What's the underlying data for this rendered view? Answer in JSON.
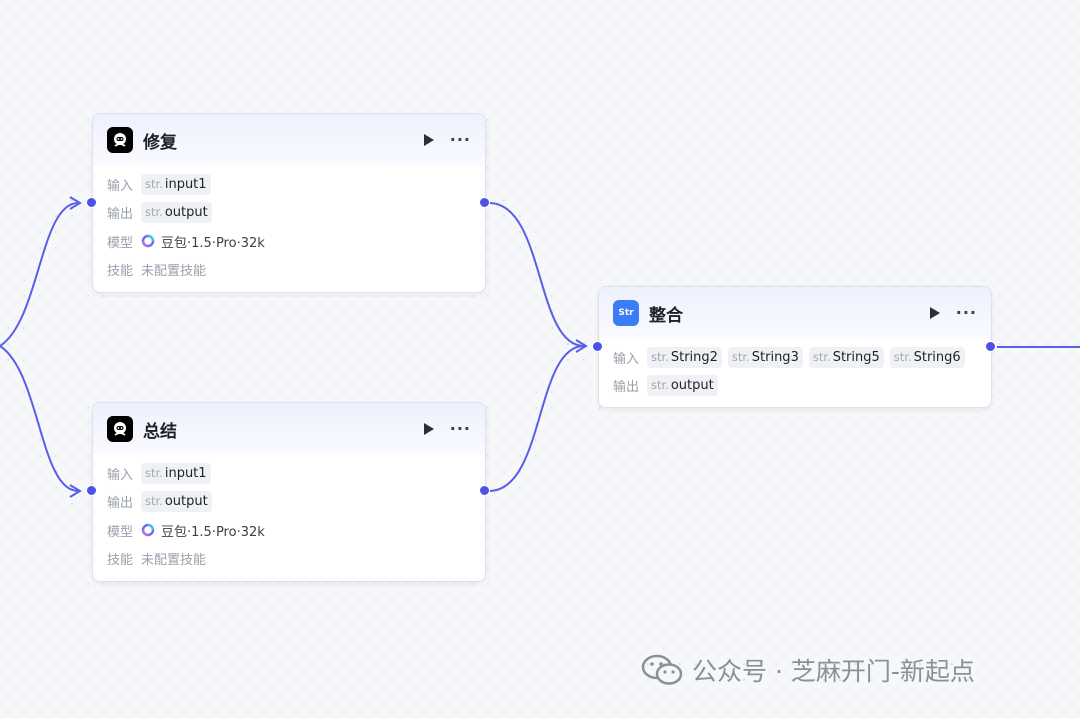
{
  "nodes": {
    "repair": {
      "title": "修复",
      "rows": {
        "input": {
          "label": "输入",
          "type": "str.",
          "value": "input1"
        },
        "output": {
          "label": "输出",
          "type": "str.",
          "value": "output"
        },
        "model": {
          "label": "模型",
          "value": "豆包·1.5·Pro·32k"
        },
        "skill": {
          "label": "技能",
          "value": "未配置技能"
        }
      }
    },
    "summary": {
      "title": "总结",
      "rows": {
        "input": {
          "label": "输入",
          "type": "str.",
          "value": "input1"
        },
        "output": {
          "label": "输出",
          "type": "str.",
          "value": "output"
        },
        "model": {
          "label": "模型",
          "value": "豆包·1.5·Pro·32k"
        },
        "skill": {
          "label": "技能",
          "value": "未配置技能"
        }
      }
    },
    "merge": {
      "title": "整合",
      "icon_text": "Str",
      "rows": {
        "input_label": "输入",
        "inputs": [
          {
            "type": "str.",
            "value": "String2"
          },
          {
            "type": "str.",
            "value": "String3"
          },
          {
            "type": "str.",
            "value": "String5"
          },
          {
            "type": "str.",
            "value": "String6"
          }
        ],
        "output": {
          "label": "输出",
          "type": "str.",
          "value": "output"
        }
      }
    }
  },
  "watermark": "公众号 · 芝麻开门-新起点",
  "colors": {
    "accent": "#4c52e6",
    "header_gradient_top": "#eef0fe",
    "str_icon_bg": "#3a7df6",
    "llm_icon_bg": "#000000"
  },
  "icons": {
    "llm_node": "llm-robot-icon",
    "merge_node": "string-icon",
    "play": "play-icon",
    "more": "more-icon",
    "model": "doubao-model-icon",
    "watermark": "wechat-icon"
  }
}
